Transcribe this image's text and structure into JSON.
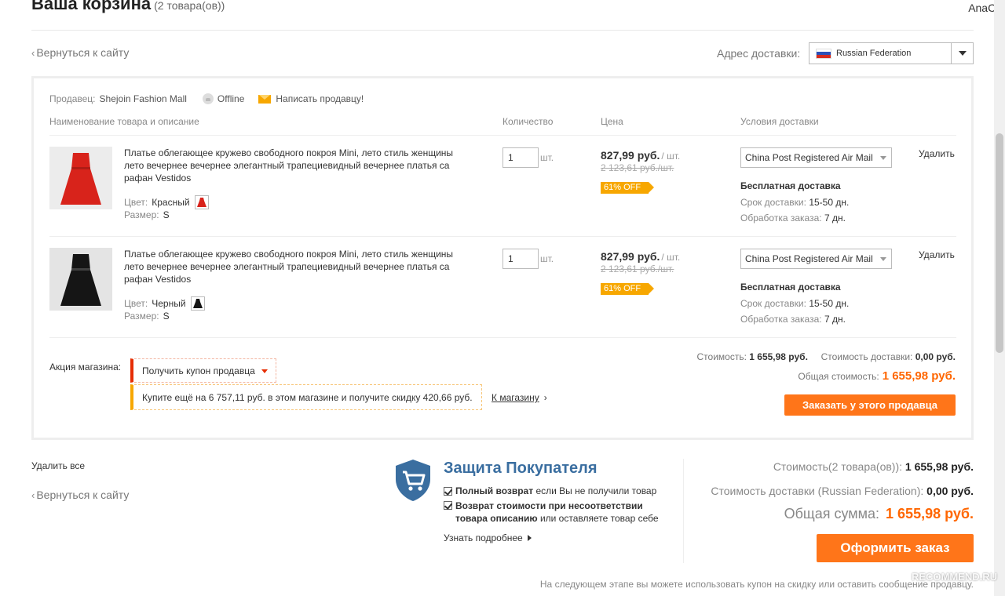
{
  "header": {
    "title": "Ваша корзина",
    "count": "(2 товара(ов))",
    "user": "AnaCa"
  },
  "nav": {
    "back_top": "Вернуться к сайту",
    "back_bottom": "Вернуться к сайту"
  },
  "shipping_country": {
    "label": "Адрес доставки:",
    "value": "Russian Federation",
    "flag_colors": [
      "#ffffff",
      "#2b50b8",
      "#d52b1e"
    ]
  },
  "seller": {
    "label": "Продавец:",
    "name": "Shejoin Fashion Mall",
    "status": "Offline",
    "message_label": "Написать продавцу!"
  },
  "columns": {
    "product": "Наименование товара и описание",
    "quantity": "Количество",
    "price": "Цена",
    "shipping": "Условия доставки"
  },
  "items": [
    {
      "title": "Платье облегающее кружево свободного покроя Mini, лето стиль женщины лето вечернее вечернее элегантный трапециевидный вечернее платья са рафан Vestidos",
      "color_label": "Цвет:",
      "color": "Красный",
      "size_label": "Размер:",
      "size": "S",
      "dress_color": "#d8231b",
      "quantity": "1",
      "unit": "шт.",
      "price": "827,99 руб.",
      "price_unit": "/ шт.",
      "old_price": "2 123,61 руб./шт.",
      "discount": "61% OFF",
      "shipping_method": "China Post Registered Air Mail",
      "free_shipping": "Бесплатная доставка",
      "delivery_label": "Срок доставки:",
      "delivery_time": "15-50 дн.",
      "processing_label": "Обработка заказа:",
      "processing_time": "7 дн.",
      "delete": "Удалить"
    },
    {
      "title": "Платье облегающее кружево свободного покроя Mini, лето стиль женщины лето вечернее вечернее элегантный трапециевидный вечернее платья са рафан Vestidos",
      "color_label": "Цвет:",
      "color": "Черный",
      "size_label": "Размер:",
      "size": "S",
      "dress_color": "#151515",
      "quantity": "1",
      "unit": "шт.",
      "price": "827,99 руб.",
      "price_unit": "/ шт.",
      "old_price": "2 123,61 руб./шт.",
      "discount": "61% OFF",
      "shipping_method": "China Post Registered Air Mail",
      "free_shipping": "Бесплатная доставка",
      "delivery_label": "Срок доставки:",
      "delivery_time": "15-50 дн.",
      "processing_label": "Обработка заказа:",
      "processing_time": "7 дн.",
      "delete": "Удалить"
    }
  ],
  "store_promo": {
    "label": "Акция магазина:",
    "coupon_button": "Получить купон продавца",
    "message": "Купите ещё на 6 757,11 руб. в этом магазине и получите скидку 420,66 руб.",
    "store_link": "К магазину"
  },
  "seller_summary": {
    "cost_label": "Стоимость:",
    "cost": "1 655,98 руб.",
    "shipping_label": "Стоимость доставки:",
    "shipping": "0,00 руб.",
    "total_label": "Общая стоимость:",
    "total": "1 655,98 руб.",
    "order_button": "Заказать у этого продавца"
  },
  "footer": {
    "delete_all": "Удалить все",
    "protection_title": "Защита Покупателя",
    "protection_1_bold": "Полный возврат",
    "protection_1_rest": " если Вы не получили товар",
    "protection_2_bold_a": "Возврат стоимости при несоответствии",
    "protection_2_bold_b": "товара описанию",
    "protection_2_rest": " или оставляете товар себе",
    "learn_more": "Узнать подробнее"
  },
  "order_summary": {
    "cost_label": "Стоимость(2 товара(ов)):",
    "cost": "1 655,98 руб.",
    "shipping_label": "Стоимость доставки (Russian Federation):",
    "shipping": "0,00 руб.",
    "total_label": "Общая сумма:",
    "total": "1 655,98 руб.",
    "checkout_button": "Оформить заказ",
    "note": "На следующем этапе вы можете использовать купон на скидку или оставить сообщение продавцу."
  },
  "colors": {
    "accent_orange": "#ff7519",
    "price_orange": "#ff6600",
    "badge_yellow": "#f7a700",
    "shield_blue": "#3a6ea0"
  },
  "watermark": "RECOMMEND.RU"
}
